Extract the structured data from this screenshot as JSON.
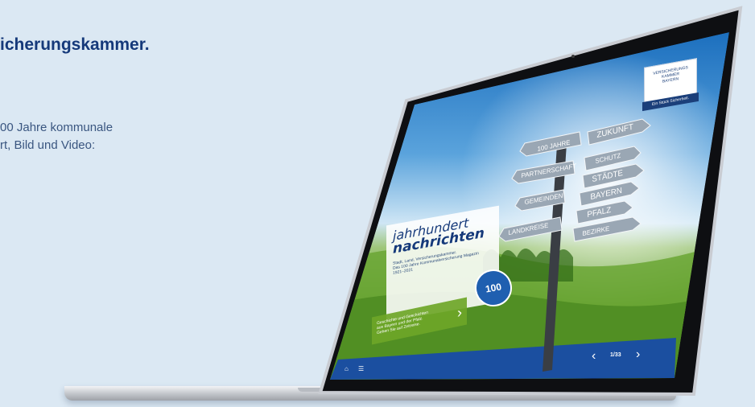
{
  "page": {
    "heading": "icherungskammer.",
    "intro_lines": [
      "00 Jahre kommunale",
      "rt, Bild und Video:"
    ]
  },
  "screen": {
    "logo_lines": [
      "VERSICHERUNGS",
      "KAMMER",
      "BAYERN"
    ],
    "logo_tagline": "Ein Stück Sicherheit.",
    "title_line1": "jahrhundert",
    "title_line2": "nachrichten",
    "subtitle": "Stadt, Land, Versicherungskammer.",
    "subtitle2": "Das 100 Jahre Kommunalversicherung Magazin",
    "years": "1921–2021",
    "teaser_lines": [
      "Geschichte und Geschichten",
      "aus Bayern und der Pfalz.",
      "Gehen Sie auf Zeitreise."
    ],
    "seal_text": "100",
    "signs_left": [
      "100 JAHRE",
      "PARTNERSCHAFT",
      "GEMEINDEN",
      "LANDKREISE"
    ],
    "signs_right": [
      "ZUKUNFT",
      "SCHUTZ",
      "STÄDTE",
      "BAYERN",
      "PFALZ",
      "BEZIRKE"
    ],
    "page_indicator": "1/33",
    "home_icon": "home-icon",
    "menu_icon": "list-icon",
    "prev_icon": "chevron-left-icon",
    "next_icon": "chevron-right-icon"
  },
  "colors": {
    "background": "#dbe8f3",
    "heading": "#15397a",
    "brand_blue": "#1b3f7a",
    "sky_top": "#1c6fbe",
    "grass": "#6ea628"
  }
}
